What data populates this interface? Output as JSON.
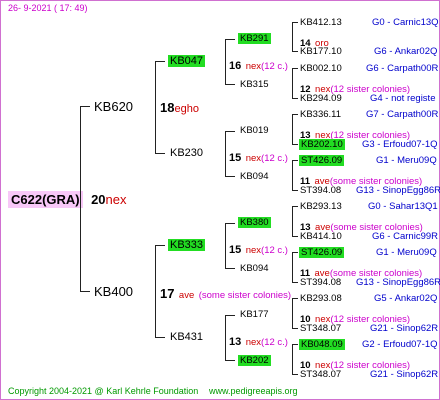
{
  "header": {
    "date": "26-  9-2021 (  17:  49)"
  },
  "footer": {
    "copyright": "Copyright 2004-2021 @ Karl Kehrle Foundation",
    "site": "www.pedigreeapis.org"
  },
  "root": {
    "id": "C622(GRA)",
    "num": "20",
    "note": "nex"
  },
  "gen1": {
    "top": {
      "id": "KB620",
      "num": "18",
      "note": "egho"
    },
    "bottom": {
      "id": "KB400",
      "num": "17",
      "note": "ave",
      "extra": "(some sister colonies)"
    }
  },
  "gen2": {
    "a": {
      "id": "KB047",
      "num": "16",
      "note": "nex",
      "extra": "(12 c.)"
    },
    "b": {
      "id": "KB230",
      "num": "15",
      "note": "nex",
      "extra": "(12 c.)"
    },
    "c": {
      "id": "KB333",
      "num": "15",
      "note": "nex",
      "extra": "(12 c.)"
    },
    "d": {
      "id": "KB431",
      "num": "13",
      "note": "nex",
      "extra": "(12 c.)"
    }
  },
  "gen3": {
    "a1": {
      "id": "KB291",
      "num": "14",
      "note": "oro"
    },
    "a2": {
      "id": "KB315",
      "num": "12",
      "note": "nex",
      "extra": "(12 sister colonies)"
    },
    "b1": {
      "id": "KB019",
      "num": "13",
      "note": "nex",
      "extra": "(12 sister colonies)"
    },
    "b2": {
      "id": "KB094",
      "num": "11",
      "note": "ave",
      "extra": "(some sister colonies)"
    },
    "c1": {
      "id": "KB380",
      "num": "13",
      "note": "ave",
      "extra": "(some sister colonies)"
    },
    "c2": {
      "id": "KB094",
      "num": "11",
      "note": "ave",
      "extra": "(some sister colonies)"
    },
    "d1": {
      "id": "KB177",
      "num": "10",
      "note": "nex",
      "extra": "(12 sister colonies)"
    },
    "d2": {
      "id": "KB202",
      "num": "10",
      "note": "nex",
      "extra": "(12 sister colonies)"
    }
  },
  "gen4": [
    {
      "id": "KB412.13",
      "desc": "G0 - Carnic13Q"
    },
    {
      "id": "KB177.10",
      "desc": "G6 - Ankar02Q"
    },
    {
      "id": "KB002.10",
      "desc": "G6 - Carpath00R"
    },
    {
      "id": "KB294.09",
      "desc": "G4 - not registe"
    },
    {
      "id": "KB336.11",
      "desc": "G7 - Carpath00R"
    },
    {
      "id": "KB202.10",
      "desc": "G3 - Erfoud07-1Q"
    },
    {
      "id": "ST426.09",
      "desc": "G1 - Meru09Q"
    },
    {
      "id": "ST394.08",
      "desc": "G13 - SinopEgg86R"
    },
    {
      "id": "KB293.13",
      "desc": "G0 - Sahar13Q1"
    },
    {
      "id": "KB414.10",
      "desc": "G6 - Carnic99R"
    },
    {
      "id": "ST426.09",
      "desc": "G1 - Meru09Q"
    },
    {
      "id": "ST394.08",
      "desc": "G13 - SinopEgg86R"
    },
    {
      "id": "KB293.08",
      "desc": "G5 - Ankar02Q"
    },
    {
      "id": "ST348.07",
      "desc": "G21 - Sinop62R"
    },
    {
      "id": "KB048.09",
      "desc": "G2 - Erfoud07-1Q"
    },
    {
      "id": "ST348.07",
      "desc": "G21 - Sinop62R"
    }
  ]
}
